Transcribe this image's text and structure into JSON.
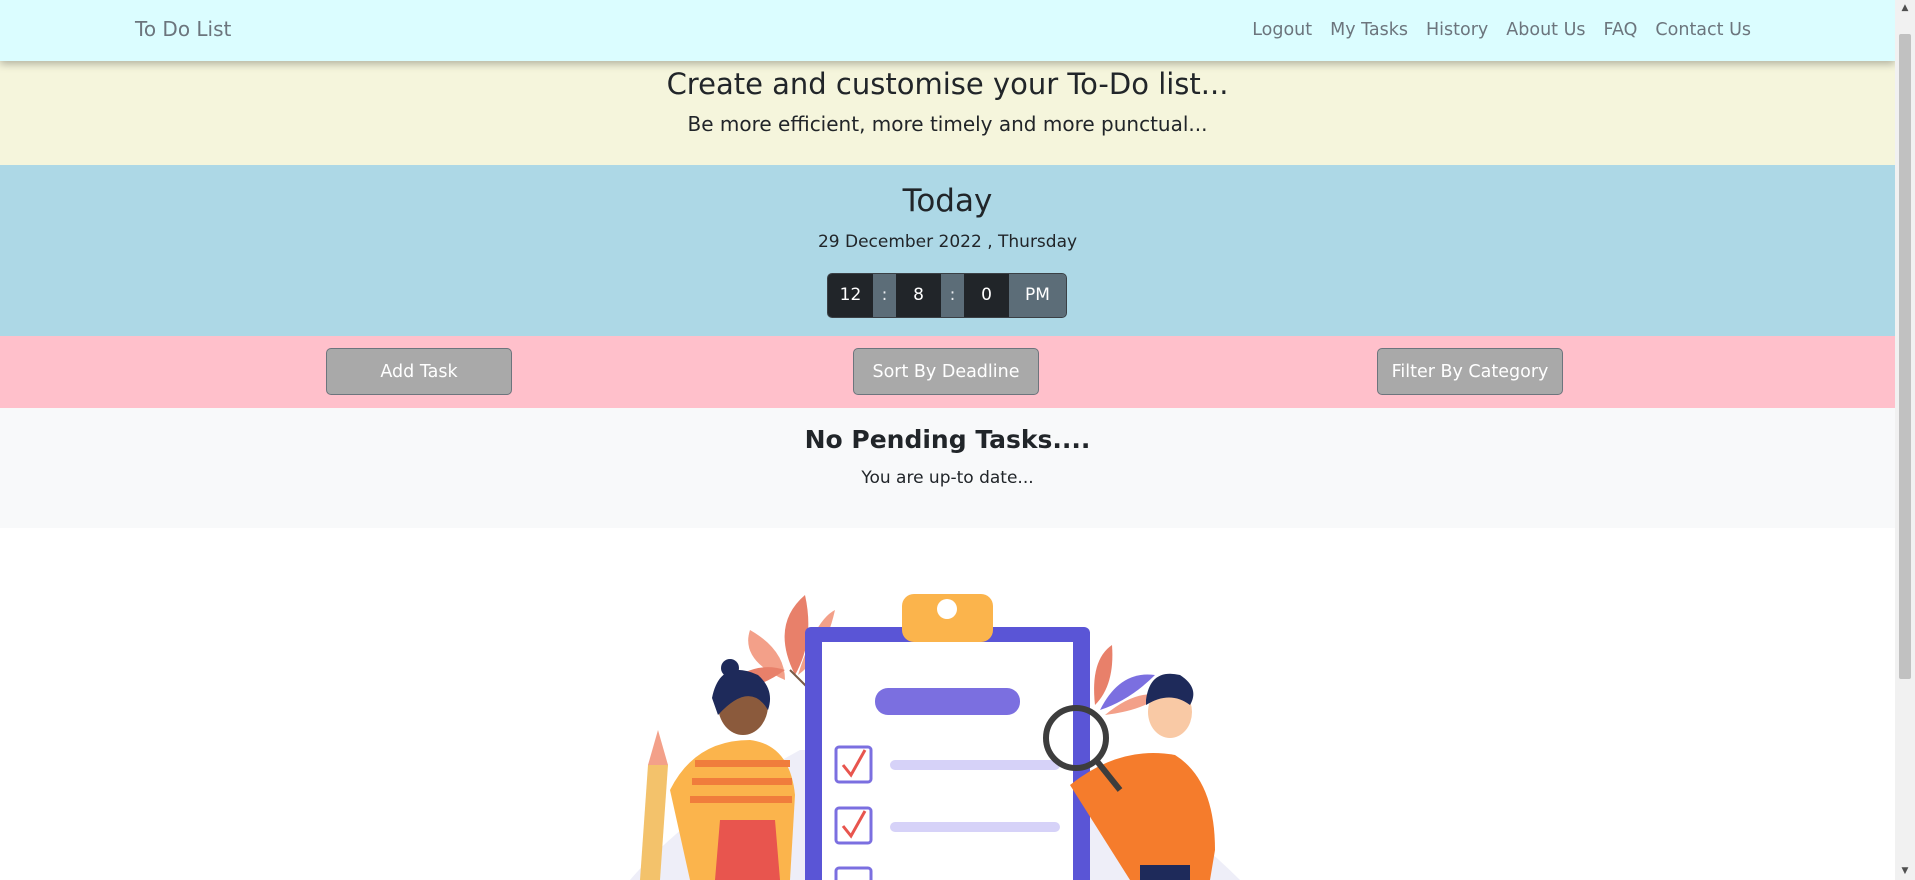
{
  "navbar": {
    "brand": "To Do List",
    "links": [
      "Logout",
      "My Tasks",
      "History",
      "About Us",
      "FAQ",
      "Contact Us"
    ]
  },
  "hero": {
    "title": "Create and customise your To-Do list...",
    "subtitle": "Be more efficient, more timely and more punctual..."
  },
  "today": {
    "title": "Today",
    "date": "29 December 2022 , Thursday",
    "clock": {
      "hours": "12",
      "minutes": "8",
      "seconds": "0",
      "separator": ":",
      "ampm": "PM"
    }
  },
  "actions": {
    "add_task": "Add Task",
    "sort": "Sort By Deadline",
    "filter": "Filter By Category"
  },
  "pending": {
    "title": "No Pending Tasks....",
    "subtitle": "You are up-to date..."
  },
  "colors": {
    "navbar": "#dbfdff",
    "hero": "#f5f5dc",
    "today": "#add8e6",
    "actions": "#ffc0cb",
    "pending": "#f8f9fa",
    "button": "#a9a9a9"
  },
  "icons": {
    "illustration": "todo-clipboard-illustration",
    "scroll_up": "scroll-up-arrow-icon",
    "scroll_down": "scroll-down-arrow-icon"
  }
}
